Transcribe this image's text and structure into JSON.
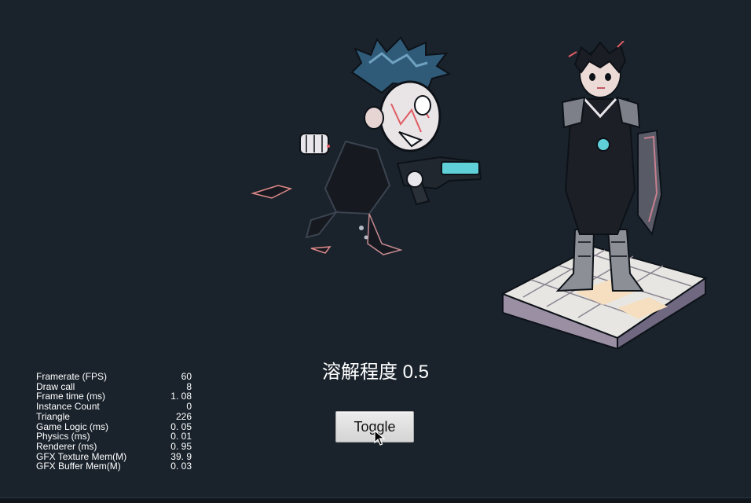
{
  "dissolve": {
    "label": "溶解程度 0.5"
  },
  "toggle": {
    "label": "Toggle"
  },
  "stats": [
    {
      "name": "Framerate (FPS)",
      "value": "60"
    },
    {
      "name": "Draw call",
      "value": "8"
    },
    {
      "name": "Frame time (ms)",
      "value": "1. 08"
    },
    {
      "name": "Instance Count",
      "value": "0"
    },
    {
      "name": "Triangle",
      "value": "226"
    },
    {
      "name": "Game Logic (ms)",
      "value": "0. 05"
    },
    {
      "name": "Physics (ms)",
      "value": "0. 01"
    },
    {
      "name": "Renderer (ms)",
      "value": "0. 95"
    },
    {
      "name": "GFX Texture Mem(M)",
      "value": "39. 9"
    },
    {
      "name": "GFX Buffer Mem(M)",
      "value": "0. 03"
    }
  ],
  "colors": {
    "background": "#1a232c",
    "hair": "#3f6f8c",
    "accent_cyan": "#5fd0d8",
    "tile_light": "#e8e6e2",
    "tile_warm": "#f5dfc0"
  }
}
